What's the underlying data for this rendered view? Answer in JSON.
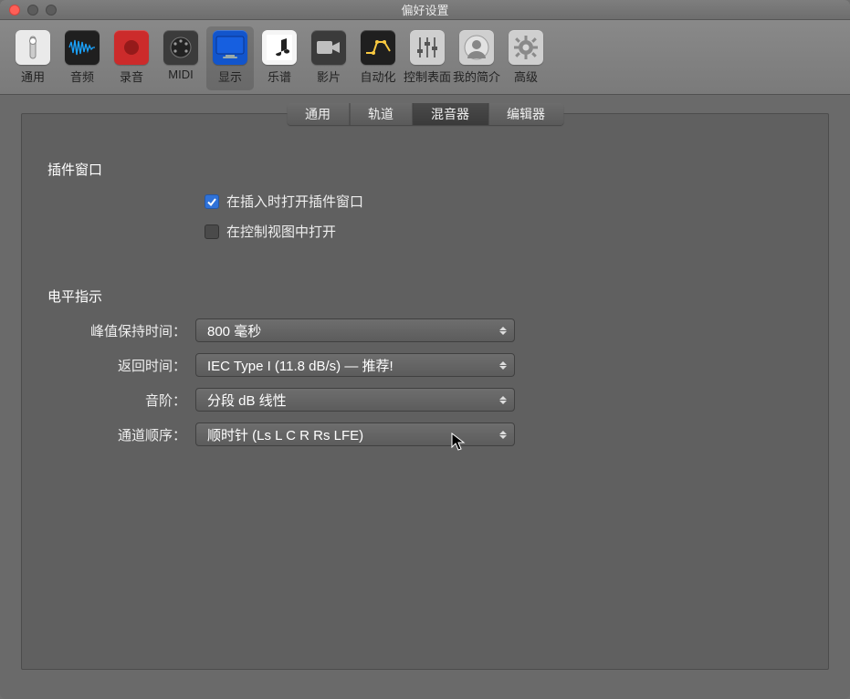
{
  "window": {
    "title": "偏好设置"
  },
  "toolbar": {
    "items": [
      {
        "label": "通用"
      },
      {
        "label": "音频"
      },
      {
        "label": "录音"
      },
      {
        "label": "MIDI"
      },
      {
        "label": "显示"
      },
      {
        "label": "乐谱"
      },
      {
        "label": "影片"
      },
      {
        "label": "自动化"
      },
      {
        "label": "控制表面"
      },
      {
        "label": "我的简介"
      },
      {
        "label": "高级"
      }
    ]
  },
  "tabs": {
    "general": "通用",
    "track": "轨道",
    "mixer": "混音器",
    "editor": "编辑器"
  },
  "pluginWindow": {
    "title": "插件窗口",
    "openOnInsert": "在插入时打开插件窗口",
    "openInControlView": "在控制视图中打开"
  },
  "levelMeter": {
    "title": "电平指示",
    "peakHoldLabel": "峰值保持时间：",
    "peakHoldValue": "800 毫秒",
    "returnTimeLabel": "返回时间：",
    "returnTimeValue": "IEC Type I (11.8 dB/s) — 推荐!",
    "scaleLabel": "音阶：",
    "scaleValue": "分段 dB 线性",
    "channelOrderLabel": "通道顺序：",
    "channelOrderValue": "顺时针 (Ls L C R Rs LFE)"
  }
}
